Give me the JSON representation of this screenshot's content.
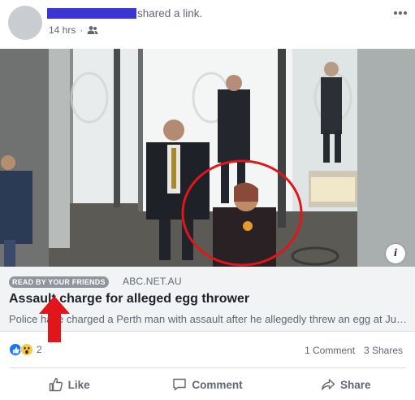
{
  "post": {
    "action_text": "shared a link.",
    "timestamp": "14 hrs",
    "audience_icon": "friends-icon",
    "more_icon": "more-options-icon"
  },
  "link": {
    "badge": "READ BY YOUR FRIENDS",
    "domain": "ABC.NET.AU",
    "headline": "Assault charge for alleged egg thrower",
    "description": "Police have charged a Perth man with assault after he allegedly threw an egg at Julia Gillard",
    "info_label": "i"
  },
  "stats": {
    "reaction_icons": [
      "like-reaction-icon",
      "wow-reaction-icon"
    ],
    "reaction_count": "2",
    "comments": "1 Comment",
    "shares": "3 Shares"
  },
  "actions": {
    "like": "Like",
    "comment": "Comment",
    "share": "Share"
  },
  "colors": {
    "link_bg": "#f2f3f5",
    "badge_bg": "#90949c",
    "redaction": "#3b35d6",
    "annotation_red": "#e0161a",
    "like_blue": "#1877f2"
  }
}
